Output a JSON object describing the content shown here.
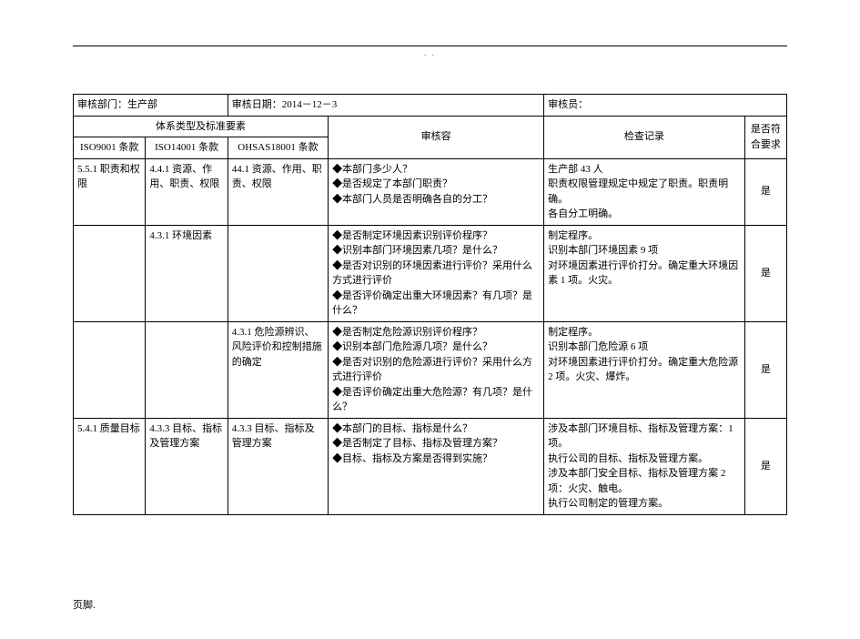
{
  "header_mark": ". .",
  "info_row": {
    "dept_label": "审核部门：",
    "dept_value": "生产部",
    "date_label": "审核日期：",
    "date_value": "2014－12－3",
    "auditor_label": "审核员：",
    "auditor_value": ""
  },
  "headers": {
    "system_type": "体系类型及标准要素",
    "iso9001": "ISO9001 条款",
    "iso14001": "ISO14001 条款",
    "ohsas": "OHSAS18001 条款",
    "audit_content": "审核容",
    "record": "检查记录",
    "conform": "是否符合要求"
  },
  "rows": [
    {
      "iso9001": "5.5.1 职责和权限",
      "iso14001": "4.4.1 资源、作用、职责、权限",
      "ohsas": "44.1 资源、作用、职责、权限",
      "content": "◆本部门多少人？\n◆是否规定了本部门职责？\n◆本部门人员是否明确各自的分工？",
      "record": "生产部 43 人\n职责权限管理规定中规定了职责。职责明确。\n各自分工明确。",
      "conform": "是"
    },
    {
      "iso9001": "",
      "iso14001": "4.3.1 环境因素",
      "ohsas": "",
      "content": "◆是否制定环境因素识别评价程序？\n◆识别本部门环境因素几项？是什么？\n◆是否对识别的环境因素进行评价？采用什么方式进行评价\n◆是否评价确定出重大环境因素？有几项？是什么？",
      "record": "制定程序。\n识别本部门环境因素 9 项\n对环境因素进行评价打分。确定重大环境因素 1 项。火灾。",
      "conform": "是"
    },
    {
      "iso9001": "",
      "iso14001": "",
      "ohsas": "4.3.1 危险源辨识、风险评价和控制措施的确定",
      "content": "◆是否制定危险源识别评价程序？\n◆识别本部门危险源几项？是什么？\n◆是否对识别的危险源进行评价？采用什么方式进行评价\n◆是否评价确定出重大危险源？有几项？是什么？",
      "record": "制定程序。\n识别本部门危险源 6 项\n对环境因素进行评价打分。确定重大危险源 2 项。火灾、爆炸。",
      "conform": "是"
    },
    {
      "iso9001": "5.4.1 质量目标",
      "iso14001": "4.3.3 目标、指标及管理方案",
      "ohsas": "4.3.3 目标、指标及管理方案",
      "content": "◆本部门的目标、指标是什么？\n◆是否制定了目标、指标及管理方案？\n◆目标、指标及方案是否得到实施？",
      "record": "涉及本部门环境目标、指标及管理方案：1 项。\n执行公司的目标、指标及管理方案。\n涉及本部门安全目标、指标及管理方案 2 项：火灾、触电。\n执行公司制定的管理方案。",
      "conform": "是"
    }
  ],
  "footer": "页脚."
}
